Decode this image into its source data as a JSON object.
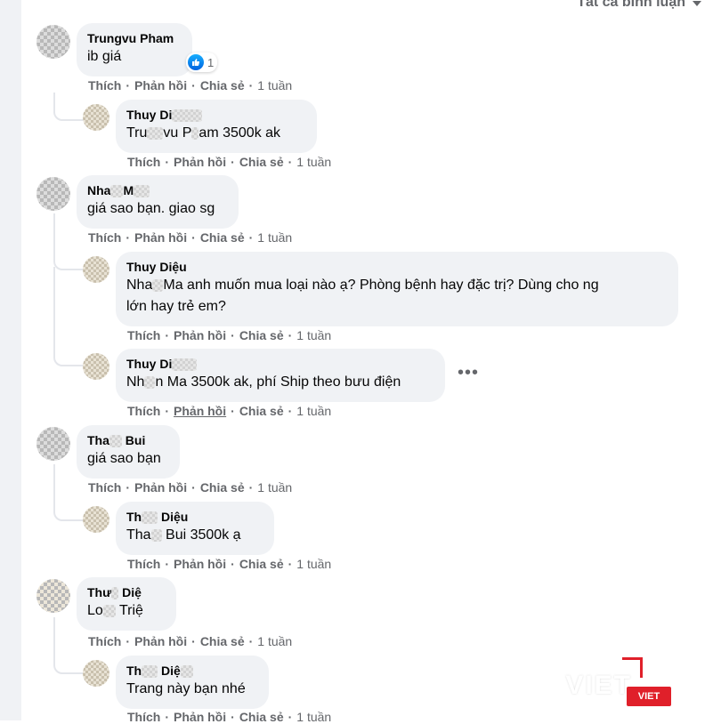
{
  "filter_label": "Tất cả bình luận",
  "actions": {
    "like": "Thích",
    "reply": "Phản hồi",
    "share": "Chia sẻ"
  },
  "more_label": "•••",
  "watermark": {
    "text": "VIET",
    "badge": "VIET"
  },
  "comments": [
    {
      "author": "Trungvu Pham",
      "text": "ib giá",
      "time": "1 tuần",
      "reaction_count": "1"
    },
    {
      "author_visible": "Thuy Di",
      "text_prefix": "Tru",
      "text_mid": "vu P",
      "text_suffix": "am 3500k ak",
      "time": "1 tuần"
    },
    {
      "author_visible": "Nha",
      "author_visible2": "M",
      "text": "giá sao bạn. giao sg",
      "time": "1 tuần"
    },
    {
      "author": "Thuy Diệu",
      "text_prefix": "Nha",
      "text_mid": "Ma",
      "text_line1": " anh muốn mua loại nào ạ? Phòng bệnh hay đặc trị? Dùng cho ng",
      "text_line2": "lớn hay trẻ em?",
      "time": "1 tuần"
    },
    {
      "author_visible": "Thuy Di",
      "text_prefix": "Nh",
      "text_mid": "n Ma",
      "text_suffix": " 3500k ak, phí Ship theo bưu điện",
      "time": "1 tuần"
    },
    {
      "author_visible": "Tha",
      "author_visible2": " Bui",
      "text": "giá sao bạn",
      "time": "1 tuần"
    },
    {
      "author_visible": "Th",
      "author_visible2": " Diệu",
      "text_prefix": "Tha",
      "text_mid": " Bui",
      "text_suffix": " 3500k ạ",
      "time": "1 tuần"
    },
    {
      "author_visible": "Thư",
      "author_visible2": " Diệ",
      "text_prefix": "Lo",
      "text_mid": " Triệ",
      "time": "1 tuần"
    },
    {
      "author_visible": "Th",
      "author_visible2": " Diệ",
      "text": "Trang này bạn nhé",
      "time": "1 tuần"
    }
  ]
}
